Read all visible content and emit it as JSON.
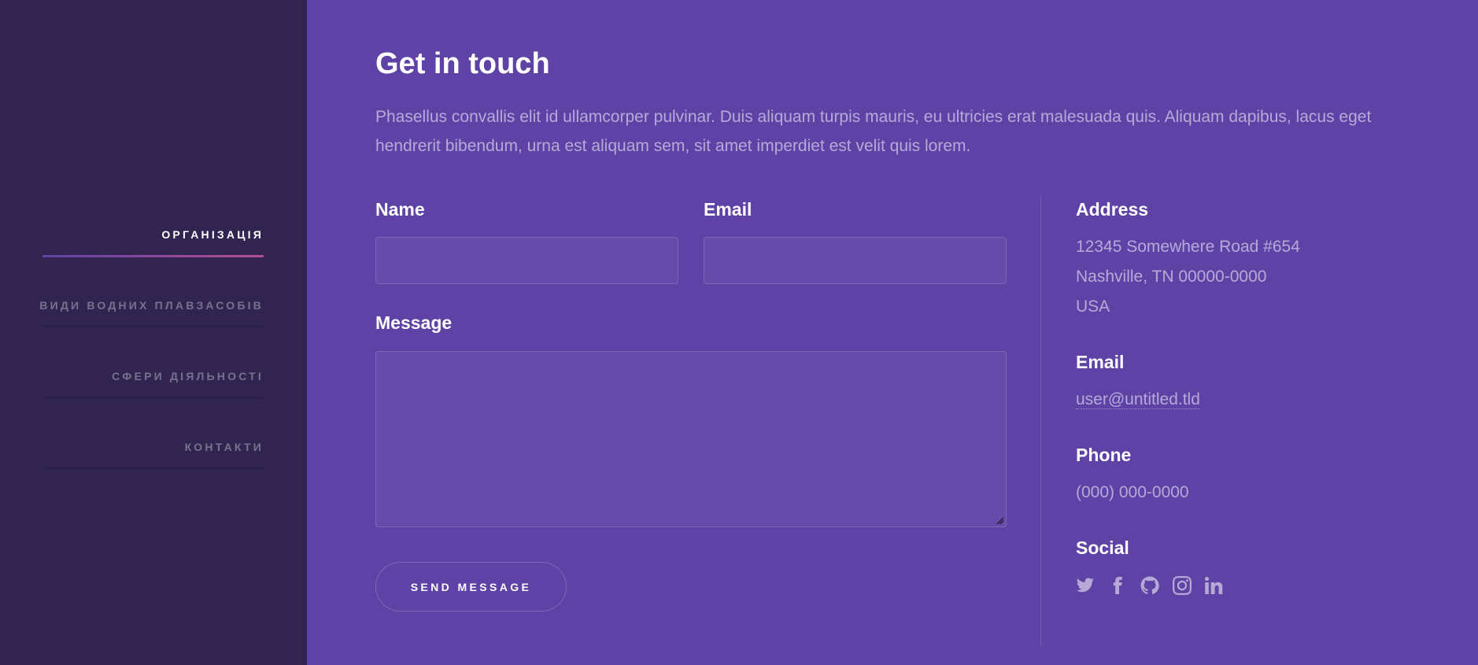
{
  "sidebar": {
    "nav": [
      {
        "label": "ОРГАНІЗАЦІЯ",
        "active": true
      },
      {
        "label": "ВИДИ ВОДНИХ ПЛАВЗАСОБІВ",
        "active": false
      },
      {
        "label": "СФЕРИ ДІЯЛЬНОСТІ",
        "active": false
      },
      {
        "label": "КОНТАКТИ",
        "active": false
      }
    ]
  },
  "contact": {
    "title": "Get in touch",
    "intro": "Phasellus convallis elit id ullamcorper pulvinar. Duis aliquam turpis mauris, eu ultricies erat malesuada quis. Aliquam dapibus, lacus eget hendrerit bibendum, urna est aliquam sem, sit amet imperdiet est velit quis lorem.",
    "form": {
      "name_label": "Name",
      "name_value": "",
      "email_label": "Email",
      "email_value": "",
      "message_label": "Message",
      "message_value": "",
      "submit_label": "SEND MESSAGE"
    },
    "info": {
      "address_heading": "Address",
      "address_line1": "12345 Somewhere Road #654",
      "address_line2": "Nashville, TN 00000-0000",
      "address_line3": "USA",
      "email_heading": "Email",
      "email": "user@untitled.tld",
      "phone_heading": "Phone",
      "phone": "(000) 000-0000",
      "social_heading": "Social",
      "social_icons": [
        "twitter-icon",
        "facebook-icon",
        "github-icon",
        "instagram-icon",
        "linkedin-icon"
      ]
    }
  },
  "colors": {
    "main_bg": "#5e42a6",
    "sidebar_bg": "#312450",
    "accent_gradient_start": "#5e42a6",
    "accent_gradient_end": "#b74e91"
  }
}
